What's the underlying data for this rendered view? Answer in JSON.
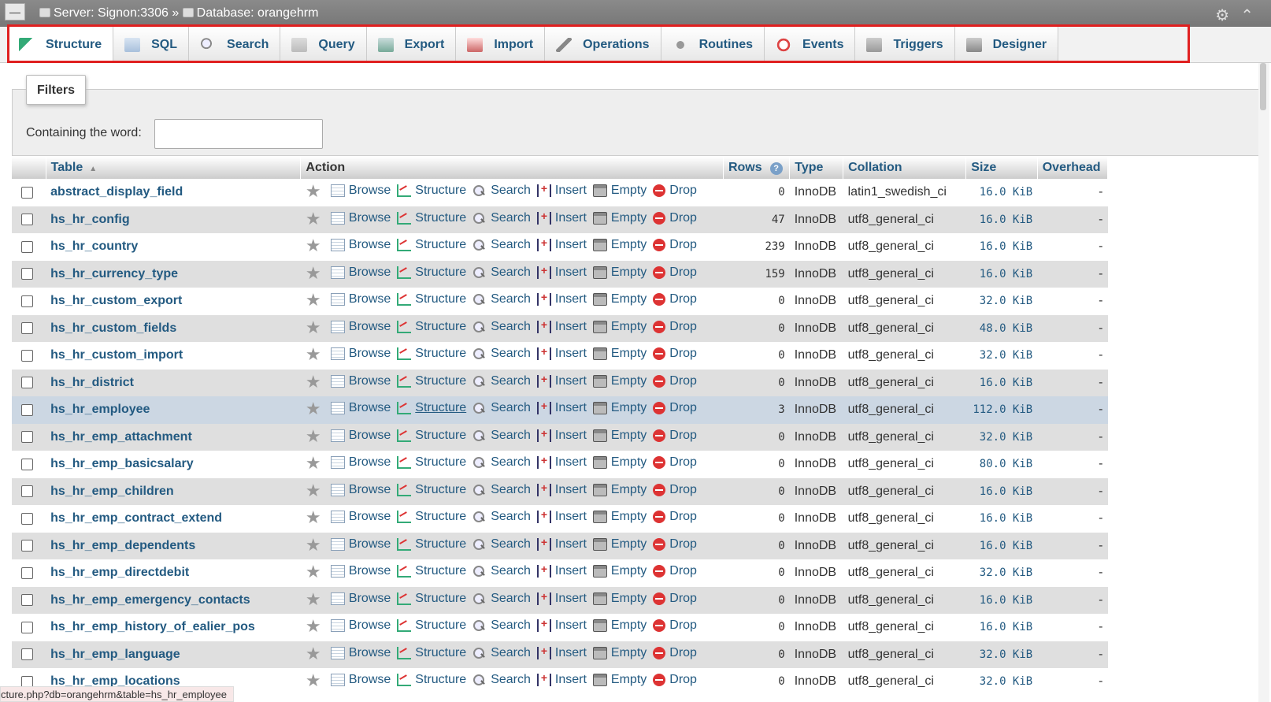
{
  "topbar": {
    "server_label": "Server: Signon:3306 »",
    "database_label": "Database: orangehrm"
  },
  "tabs": [
    {
      "label": "Structure",
      "icon": "structure-icon",
      "active": true
    },
    {
      "label": "SQL",
      "icon": "sql-icon"
    },
    {
      "label": "Search",
      "icon": "search-icon"
    },
    {
      "label": "Query",
      "icon": "query-icon"
    },
    {
      "label": "Export",
      "icon": "export-icon"
    },
    {
      "label": "Import",
      "icon": "import-icon"
    },
    {
      "label": "Operations",
      "icon": "wrench-icon"
    },
    {
      "label": "Routines",
      "icon": "routines-icon"
    },
    {
      "label": "Events",
      "icon": "clock-icon"
    },
    {
      "label": "Triggers",
      "icon": "triggers-icon"
    },
    {
      "label": "Designer",
      "icon": "designer-icon"
    }
  ],
  "filters": {
    "legend": "Filters",
    "label": "Containing the word:",
    "value": ""
  },
  "table": {
    "headers": {
      "table": "Table",
      "action": "Action",
      "rows": "Rows",
      "type": "Type",
      "collation": "Collation",
      "size": "Size",
      "overhead": "Overhead"
    },
    "actions": [
      "Browse",
      "Structure",
      "Search",
      "Insert",
      "Empty",
      "Drop"
    ],
    "rows": [
      {
        "name": "abstract_display_field",
        "rows": "0",
        "type": "InnoDB",
        "collation": "latin1_swedish_ci",
        "size": "16.0 KiB",
        "overhead": "-"
      },
      {
        "name": "hs_hr_config",
        "rows": "47",
        "type": "InnoDB",
        "collation": "utf8_general_ci",
        "size": "16.0 KiB",
        "overhead": "-"
      },
      {
        "name": "hs_hr_country",
        "rows": "239",
        "type": "InnoDB",
        "collation": "utf8_general_ci",
        "size": "16.0 KiB",
        "overhead": "-"
      },
      {
        "name": "hs_hr_currency_type",
        "rows": "159",
        "type": "InnoDB",
        "collation": "utf8_general_ci",
        "size": "16.0 KiB",
        "overhead": "-"
      },
      {
        "name": "hs_hr_custom_export",
        "rows": "0",
        "type": "InnoDB",
        "collation": "utf8_general_ci",
        "size": "32.0 KiB",
        "overhead": "-"
      },
      {
        "name": "hs_hr_custom_fields",
        "rows": "0",
        "type": "InnoDB",
        "collation": "utf8_general_ci",
        "size": "48.0 KiB",
        "overhead": "-"
      },
      {
        "name": "hs_hr_custom_import",
        "rows": "0",
        "type": "InnoDB",
        "collation": "utf8_general_ci",
        "size": "32.0 KiB",
        "overhead": "-"
      },
      {
        "name": "hs_hr_district",
        "rows": "0",
        "type": "InnoDB",
        "collation": "utf8_general_ci",
        "size": "16.0 KiB",
        "overhead": "-"
      },
      {
        "name": "hs_hr_employee",
        "rows": "3",
        "type": "InnoDB",
        "collation": "utf8_general_ci",
        "size": "112.0 KiB",
        "overhead": "-",
        "highlighted": true
      },
      {
        "name": "hs_hr_emp_attachment",
        "rows": "0",
        "type": "InnoDB",
        "collation": "utf8_general_ci",
        "size": "32.0 KiB",
        "overhead": "-"
      },
      {
        "name": "hs_hr_emp_basicsalary",
        "rows": "0",
        "type": "InnoDB",
        "collation": "utf8_general_ci",
        "size": "80.0 KiB",
        "overhead": "-"
      },
      {
        "name": "hs_hr_emp_children",
        "rows": "0",
        "type": "InnoDB",
        "collation": "utf8_general_ci",
        "size": "16.0 KiB",
        "overhead": "-"
      },
      {
        "name": "hs_hr_emp_contract_extend",
        "rows": "0",
        "type": "InnoDB",
        "collation": "utf8_general_ci",
        "size": "16.0 KiB",
        "overhead": "-"
      },
      {
        "name": "hs_hr_emp_dependents",
        "rows": "0",
        "type": "InnoDB",
        "collation": "utf8_general_ci",
        "size": "16.0 KiB",
        "overhead": "-"
      },
      {
        "name": "hs_hr_emp_directdebit",
        "rows": "0",
        "type": "InnoDB",
        "collation": "utf8_general_ci",
        "size": "32.0 KiB",
        "overhead": "-"
      },
      {
        "name": "hs_hr_emp_emergency_contacts",
        "rows": "0",
        "type": "InnoDB",
        "collation": "utf8_general_ci",
        "size": "16.0 KiB",
        "overhead": "-"
      },
      {
        "name": "hs_hr_emp_history_of_ealier_pos",
        "rows": "0",
        "type": "InnoDB",
        "collation": "utf8_general_ci",
        "size": "16.0 KiB",
        "overhead": "-"
      },
      {
        "name": "hs_hr_emp_language",
        "rows": "0",
        "type": "InnoDB",
        "collation": "utf8_general_ci",
        "size": "32.0 KiB",
        "overhead": "-"
      },
      {
        "name": "hs_hr_emp_locations",
        "rows": "0",
        "type": "InnoDB",
        "collation": "utf8_general_ci",
        "size": "32.0 KiB",
        "overhead": "-"
      }
    ]
  },
  "status_url": "cture.php?db=orangehrm&table=hs_hr_employee",
  "colors": {
    "link": "#235a81",
    "highlight_box": "#e02020",
    "row_highlight": "#ccd7e3"
  }
}
